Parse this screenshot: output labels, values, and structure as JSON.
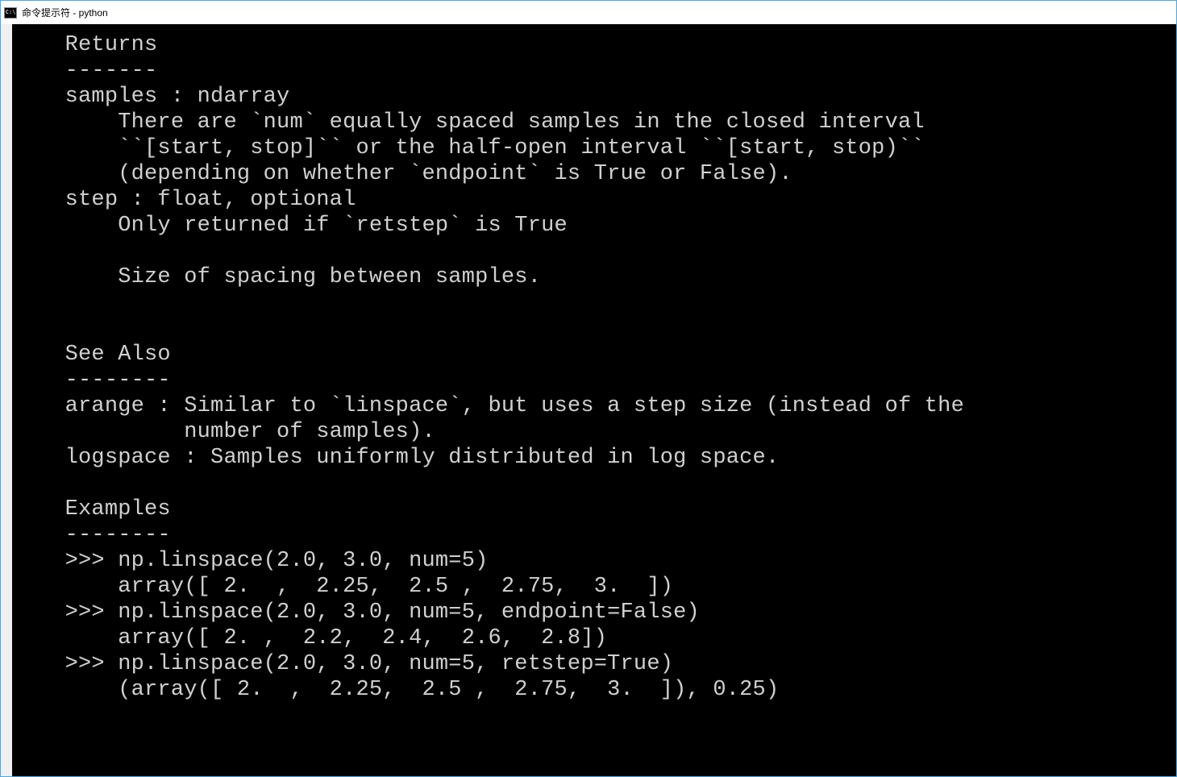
{
  "titlebar": {
    "icon_label": "C:\\",
    "title": "命令提示符 - python"
  },
  "lines": [
    "    Returns",
    "    -------",
    "    samples : ndarray",
    "        There are `num` equally spaced samples in the closed interval",
    "        ``[start, stop]`` or the half-open interval ``[start, stop)``",
    "        (depending on whether `endpoint` is True or False).",
    "    step : float, optional",
    "        Only returned if `retstep` is True",
    "",
    "        Size of spacing between samples.",
    "",
    "",
    "    See Also",
    "    --------",
    "    arange : Similar to `linspace`, but uses a step size (instead of the",
    "             number of samples).",
    "    logspace : Samples uniformly distributed in log space.",
    "",
    "    Examples",
    "    --------",
    "    >>> np.linspace(2.0, 3.0, num=5)",
    "        array([ 2.  ,  2.25,  2.5 ,  2.75,  3.  ])",
    "    >>> np.linspace(2.0, 3.0, num=5, endpoint=False)",
    "        array([ 2. ,  2.2,  2.4,  2.6,  2.8])",
    "    >>> np.linspace(2.0, 3.0, num=5, retstep=True)",
    "        (array([ 2.  ,  2.25,  2.5 ,  2.75,  3.  ]), 0.25)"
  ]
}
